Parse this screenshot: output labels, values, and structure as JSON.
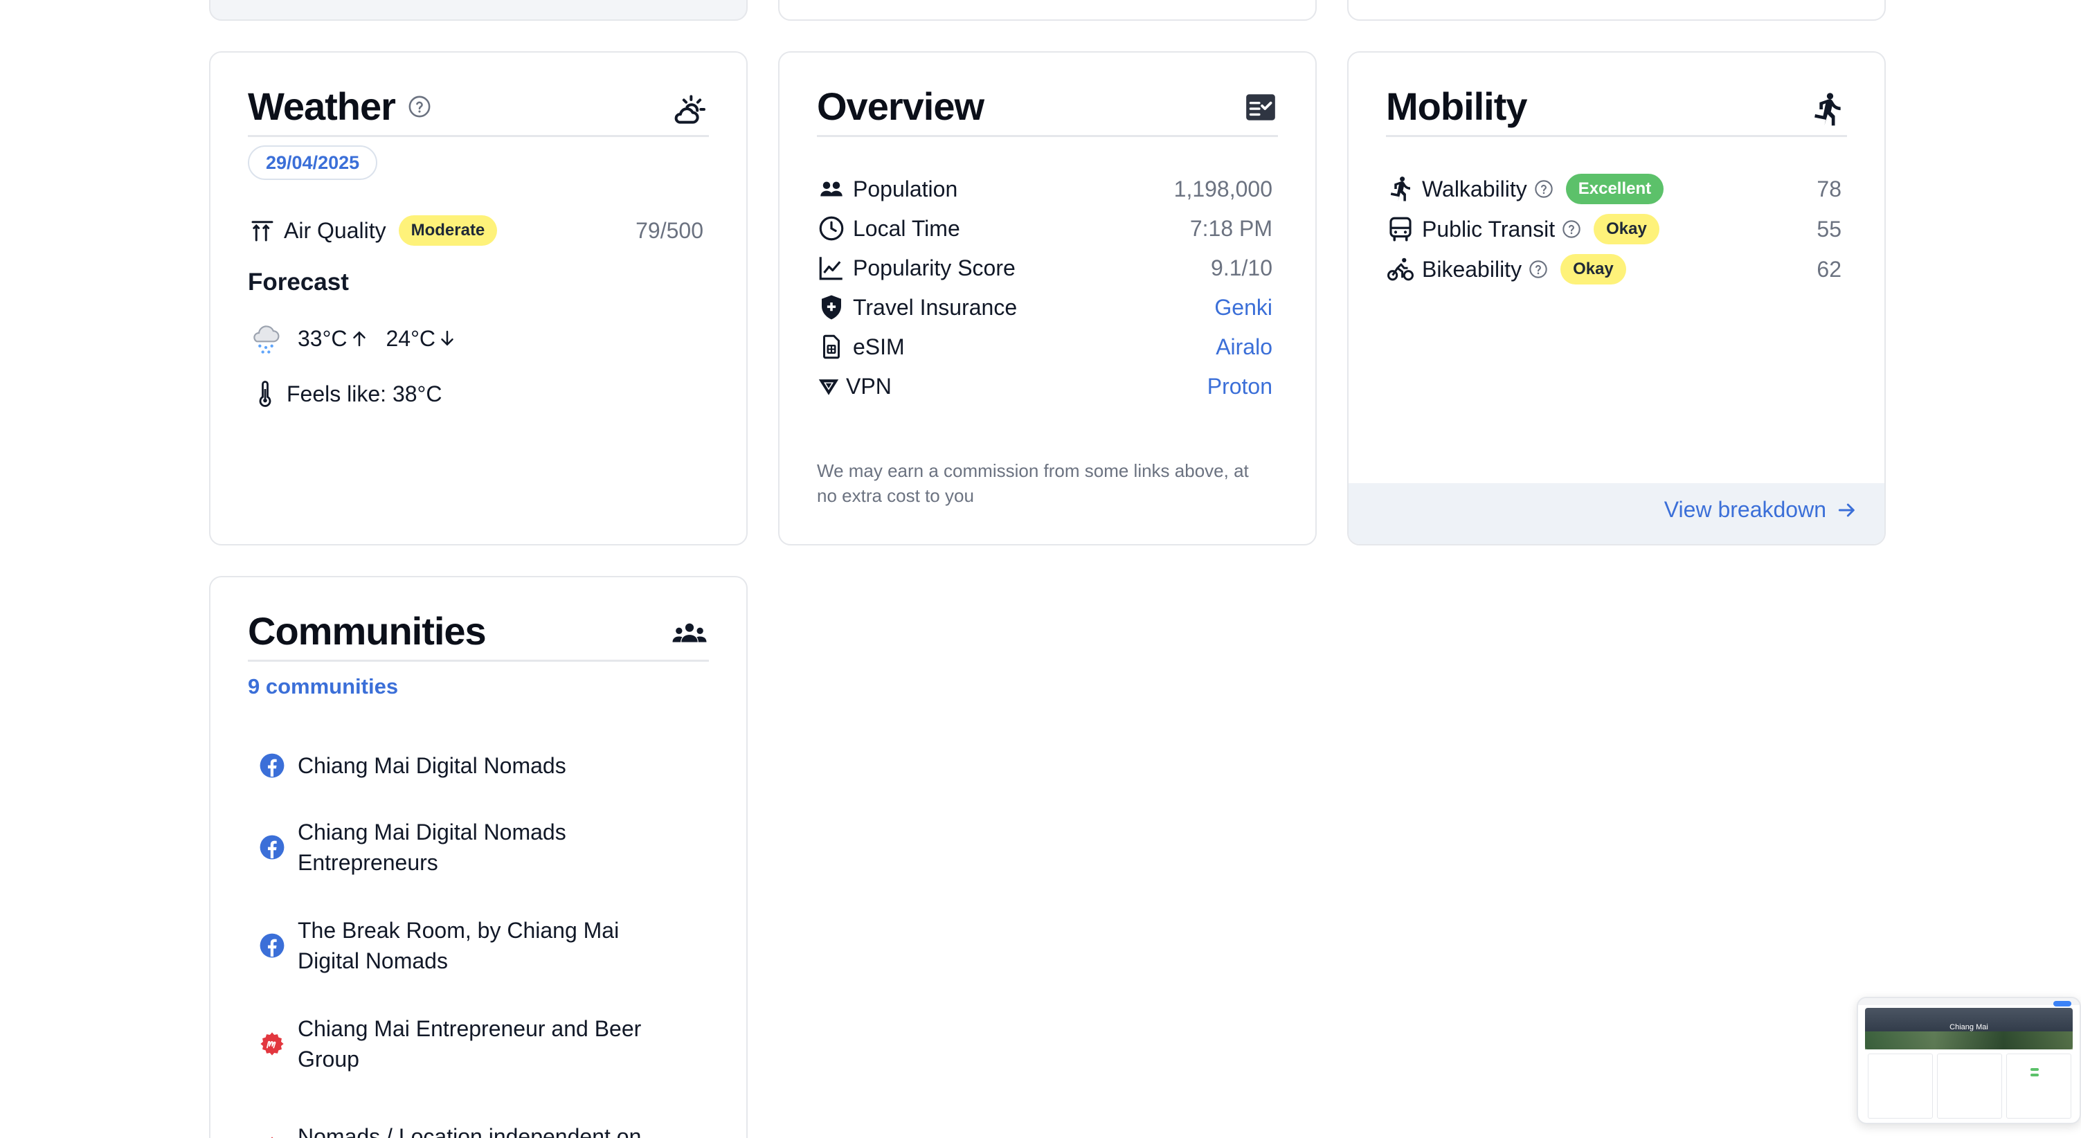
{
  "weather": {
    "title": "Weather",
    "date": "29/04/2025",
    "air_quality_label": "Air Quality",
    "air_quality_badge": "Moderate",
    "air_quality_value": "79/500",
    "forecast_title": "Forecast",
    "temp_high": "33°C",
    "temp_low": "24°C",
    "feels_like": "Feels like: 38°C"
  },
  "overview": {
    "title": "Overview",
    "rows": [
      {
        "label": "Population",
        "value": "1,198,000"
      },
      {
        "label": "Local Time",
        "value": "7:18 PM"
      },
      {
        "label": "Popularity Score",
        "value": "9.1/10"
      },
      {
        "label": "Travel Insurance",
        "value": "Genki"
      },
      {
        "label": "eSIM",
        "value": "Airalo"
      },
      {
        "label": "VPN",
        "value": "Proton"
      }
    ],
    "note": "We may earn a commission from some links above, at no extra cost to you"
  },
  "mobility": {
    "title": "Mobility",
    "rows": [
      {
        "label": "Walkability",
        "badge": "Excellent",
        "value": "78"
      },
      {
        "label": "Public Transit",
        "badge": "Okay",
        "value": "55"
      },
      {
        "label": "Bikeability",
        "badge": "Okay",
        "value": "62"
      }
    ],
    "view_breakdown": "View breakdown"
  },
  "communities": {
    "title": "Communities",
    "count": "9 communities",
    "items": [
      {
        "name": "Chiang Mai Digital Nomads",
        "icon": "facebook-icon"
      },
      {
        "name": "Chiang Mai Digital Nomads Entrepreneurs",
        "icon": "facebook-icon"
      },
      {
        "name": "The Break Room, by Chiang Mai Digital Nomads",
        "icon": "facebook-icon"
      },
      {
        "name": "Chiang Mai Entrepreneur and Beer Group",
        "icon": "meetup-icon"
      },
      {
        "name": "Nomads / Location independent on",
        "icon": "meetup-icon"
      }
    ]
  },
  "thumbnail": {
    "caption": "Chiang Mai"
  },
  "colors": {
    "accent": "#3b6fd8",
    "badge_yellow": "#fef27a",
    "badge_green": "#5cc16a",
    "border": "#e5e7eb"
  }
}
